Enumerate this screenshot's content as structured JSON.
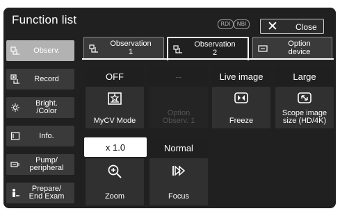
{
  "header": {
    "title": "Function list",
    "rdi_badge": "RDI",
    "nbi_badge": "NBI",
    "close_label": "Close"
  },
  "sidebar": {
    "items": [
      {
        "label": "Observ.",
        "icon": "observation-icon",
        "active": true
      },
      {
        "label": "Record",
        "icon": "record-icon",
        "active": false
      },
      {
        "label": "Bright.\n/Color",
        "icon": "brightness-icon",
        "active": false
      },
      {
        "label": "Info.",
        "icon": "info-icon",
        "active": false
      },
      {
        "label": "Pump/\nperipheral",
        "icon": "pump-icon",
        "active": false
      },
      {
        "label": "Prepare/\nEnd Exam",
        "icon": "prepare-icon",
        "active": false
      }
    ]
  },
  "tabs": [
    {
      "label": "Observation\n1",
      "icon": "observation-icon",
      "active": false
    },
    {
      "label": "Observation\n2",
      "icon": "observation-icon",
      "active": true
    },
    {
      "label": "Option\ndevice",
      "icon": "option-device-icon",
      "active": false
    }
  ],
  "functions": [
    {
      "value": "OFF",
      "label": "MyCV Mode",
      "icon": "mycv-mode-icon",
      "enabled": true
    },
    {
      "value": "--",
      "label": "Option\nObserv. 1",
      "icon": "",
      "enabled": false
    },
    {
      "value": "Live image",
      "label": "Freeze",
      "icon": "freeze-icon",
      "enabled": true
    },
    {
      "value": "Large",
      "label": "Scope image\nsize (HD/4K)",
      "icon": "scope-image-size-icon",
      "enabled": true
    },
    {
      "value": "x 1.0",
      "label": "Zoom",
      "icon": "zoom-icon",
      "enabled": true,
      "selected": true
    },
    {
      "value": "Normal",
      "label": "Focus",
      "icon": "focus-icon",
      "enabled": true
    }
  ],
  "colors": {
    "background": "#202020",
    "button": "#303030",
    "sidebar_active": "#b2b2b2",
    "text": "#ffffff"
  }
}
